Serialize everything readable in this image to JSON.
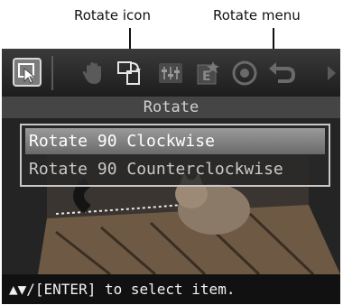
{
  "callouts": {
    "rotate_icon": "Rotate icon",
    "rotate_menu": "Rotate menu"
  },
  "toolbar": {
    "tools": [
      "select-icon",
      "hand-icon",
      "rotate-icon",
      "adjust-icon",
      "edit-icon",
      "eye-icon",
      "undo-icon",
      "right-arrow-icon"
    ]
  },
  "title": "Rotate",
  "menu": {
    "items": [
      {
        "label": "Rotate 90 Clockwise",
        "selected": true
      },
      {
        "label": "Rotate 90 Counterclockwise",
        "selected": false
      }
    ]
  },
  "status": "▲▼/[ENTER] to select item.",
  "colors": {
    "highlight": "#8a8a8a",
    "active_tool": "#7b7b7b"
  }
}
